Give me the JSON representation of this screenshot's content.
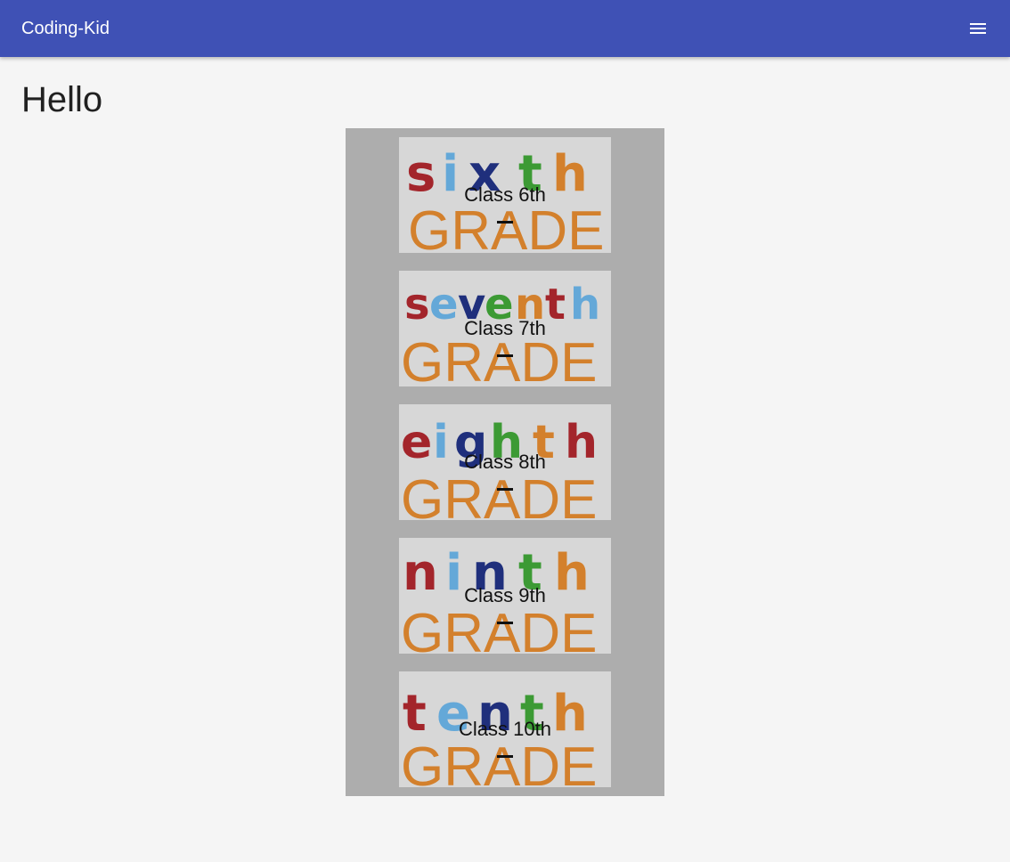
{
  "app": {
    "brand": "Coding-Kid",
    "menu_icon": "menu-icon"
  },
  "page": {
    "title": "Hello"
  },
  "colors": {
    "toolbar": "#3f51b5",
    "panel": "#adadad",
    "grade_text": "#d3802c",
    "red": "#a3252b",
    "blue": "#1f2f7c",
    "green": "#3c9a34",
    "orange": "#d3802c",
    "light_blue": "#64a8d8"
  },
  "grades": [
    {
      "label": "Class 6th",
      "word": "sixth",
      "banner": "GRADE"
    },
    {
      "label": "Class 7th",
      "word": "seventh",
      "banner": "GRADE"
    },
    {
      "label": "Class 8th",
      "word": "eighth",
      "banner": "GRADE"
    },
    {
      "label": "Class 9th",
      "word": "ninth",
      "banner": "GRADE"
    },
    {
      "label": "Class 10th",
      "word": "tenth",
      "banner": "GRADE"
    }
  ]
}
